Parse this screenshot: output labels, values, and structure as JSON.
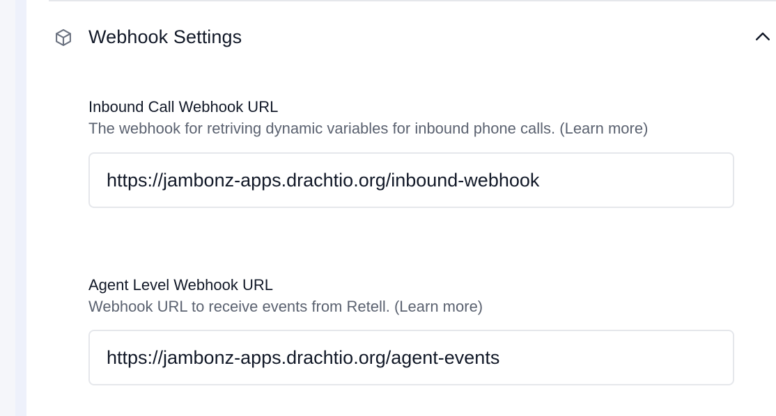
{
  "section": {
    "title": "Webhook Settings",
    "icon": "cube-icon",
    "toggle_icon": "chevron-up-icon"
  },
  "fields": {
    "inbound": {
      "label": "Inbound Call Webhook URL",
      "description": "The webhook for retriving dynamic variables for inbound phone calls. (Learn more)",
      "value": "https://jambonz-apps.drachtio.org/inbound-webhook"
    },
    "agent": {
      "label": "Agent Level Webhook URL",
      "description": "Webhook URL to receive events from Retell. (Learn more)",
      "value": "https://jambonz-apps.drachtio.org/agent-events"
    }
  },
  "colors": {
    "text": "#111827",
    "muted": "#5b6270",
    "border": "#e5e7eb",
    "rail": "#f5f6fa"
  }
}
